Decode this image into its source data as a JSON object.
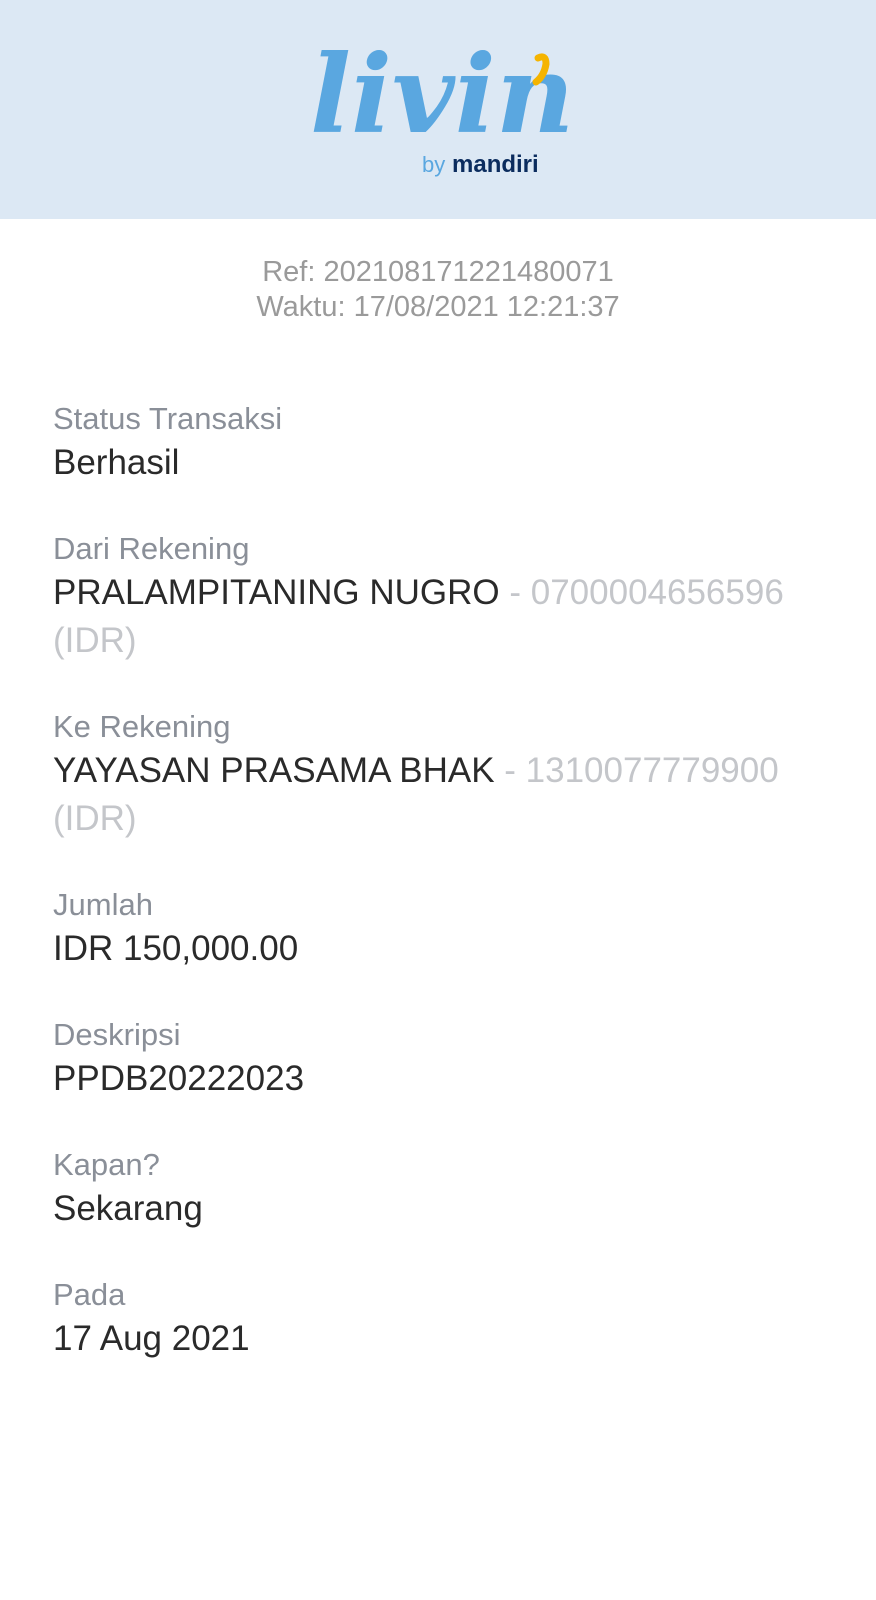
{
  "brand": {
    "logo_text": "livin'",
    "sub_prefix": "by",
    "sub_brand": "mandiri",
    "colors": {
      "logo_blue": "#5aa7e0",
      "accent_yellow": "#f5b400",
      "navy": "#0b2c5e",
      "header_bg": "#dce8f4"
    }
  },
  "meta": {
    "ref": "Ref: 202108171221480071",
    "time": "Waktu: 17/08/2021 12:21:37"
  },
  "fields": {
    "status": {
      "label": "Status Transaksi",
      "value": "Berhasil"
    },
    "from": {
      "label": "Dari Rekening",
      "name": "PRALAMPITANING NUGRO",
      "account": " - 0700004656596",
      "currency": "(IDR)"
    },
    "to": {
      "label": "Ke Rekening",
      "name": "YAYASAN PRASAMA BHAK",
      "account": " - 1310077779900",
      "currency": "(IDR)"
    },
    "amount": {
      "label": "Jumlah",
      "value": "IDR 150,000.00"
    },
    "description": {
      "label": "Deskripsi",
      "value": "PPDB20222023"
    },
    "when": {
      "label": "Kapan?",
      "value": "Sekarang"
    },
    "on": {
      "label": "Pada",
      "value": "17 Aug 2021"
    }
  }
}
